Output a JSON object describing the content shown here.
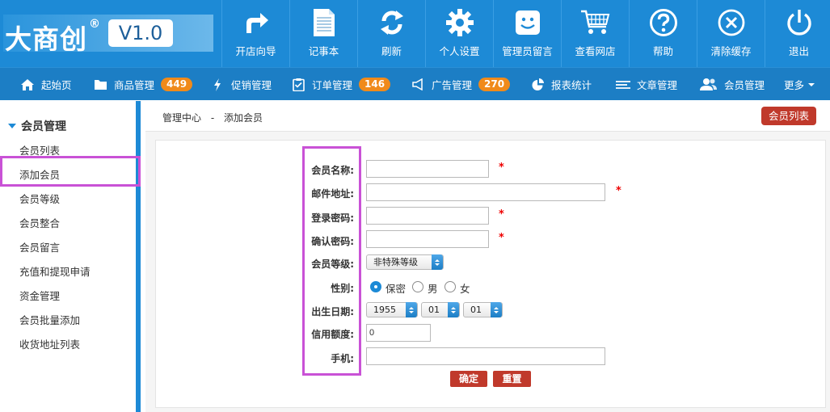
{
  "app": {
    "logo_text": "大商创",
    "logo_mark": "®",
    "version": "V1.0"
  },
  "topnav": [
    {
      "label": "开店向导",
      "icon": "share-arrow-icon"
    },
    {
      "label": "记事本",
      "icon": "notepad-icon"
    },
    {
      "label": "刷新",
      "icon": "refresh-icon"
    },
    {
      "label": "个人设置",
      "icon": "gear-icon"
    },
    {
      "label": "管理员留言",
      "icon": "smiley-message-icon"
    },
    {
      "label": "查看网店",
      "icon": "cart-icon"
    },
    {
      "label": "帮助",
      "icon": "question-icon"
    },
    {
      "label": "清除缓存",
      "icon": "clear-cache-icon"
    },
    {
      "label": "退出",
      "icon": "power-icon"
    }
  ],
  "subnav": [
    {
      "label": "起始页",
      "icon": "home-icon"
    },
    {
      "label": "商品管理",
      "icon": "folder-icon",
      "badge": "449"
    },
    {
      "label": "促销管理",
      "icon": "lightning-icon"
    },
    {
      "label": "订单管理",
      "icon": "clipboard-icon",
      "badge": "146"
    },
    {
      "label": "广告管理",
      "icon": "megaphone-icon",
      "badge": "270"
    },
    {
      "label": "报表统计",
      "icon": "pie-chart-icon"
    },
    {
      "label": "文章管理",
      "icon": "list-icon"
    },
    {
      "label": "会员管理",
      "icon": "users-icon"
    },
    {
      "label": "更多"
    }
  ],
  "sidebar": {
    "heading": "会员管理",
    "items": [
      {
        "label": "会员列表"
      },
      {
        "label": "添加会员",
        "active": true
      },
      {
        "label": "会员等级"
      },
      {
        "label": "会员整合"
      },
      {
        "label": "会员留言"
      },
      {
        "label": "充值和提现申请"
      },
      {
        "label": "资金管理"
      },
      {
        "label": "会员批量添加"
      },
      {
        "label": "收货地址列表"
      }
    ]
  },
  "breadcrumb": {
    "root": "管理中心",
    "separator": "-",
    "current": "添加会员"
  },
  "list_button": "会员列表",
  "form": {
    "fields": {
      "username": {
        "label": "会员名称:",
        "value": "",
        "required": "*"
      },
      "email": {
        "label": "邮件地址:",
        "value": "",
        "required": "*"
      },
      "password": {
        "label": "登录密码:",
        "value": "",
        "required": "*"
      },
      "confirm_password": {
        "label": "确认密码:",
        "value": "",
        "required": "*"
      },
      "rank": {
        "label": "会员等级:",
        "selected": "非特殊等级"
      },
      "gender": {
        "label": "性别:",
        "options": [
          "保密",
          "男",
          "女"
        ],
        "selected": "保密"
      },
      "birthday": {
        "label": "出生日期:",
        "year": "1955",
        "month": "01",
        "day": "01"
      },
      "credit": {
        "label": "信用额度:",
        "value": "0"
      },
      "mobile": {
        "label": "手机:",
        "value": ""
      }
    },
    "submit_label": "确定",
    "reset_label": "重置"
  },
  "colors": {
    "topbar": "#1d8ad6",
    "subnav": "#1c7ec5",
    "badge": "#f08a1a",
    "danger_button": "#c0392b",
    "highlight": "#c952d6"
  }
}
